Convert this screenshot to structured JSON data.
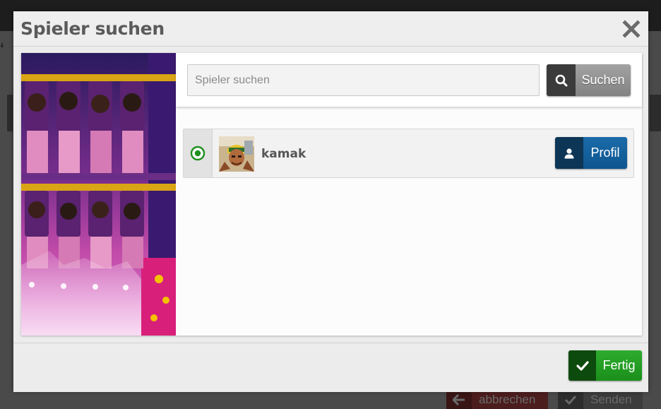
{
  "modal": {
    "title": "Spieler suchen"
  },
  "search": {
    "placeholder": "Spieler suchen",
    "value": "",
    "button_label": "Suchen"
  },
  "results": [
    {
      "name": "kamak",
      "selected": true,
      "profile_label": "Profil"
    }
  ],
  "footer": {
    "done_label": "Fertig"
  },
  "background": {
    "cancel_label": "abbrechen",
    "send_label": "Senden"
  },
  "icons": {
    "close": "close-icon",
    "search": "search-icon",
    "radio": "radio-selected-icon",
    "user": "user-icon",
    "check": "check-icon",
    "arrow_left": "arrow-left-icon"
  },
  "colors": {
    "profile_button": "#1565a6",
    "done_button": "#229c22",
    "search_button": "#929292",
    "radio_selected": "#1e8f1e"
  }
}
